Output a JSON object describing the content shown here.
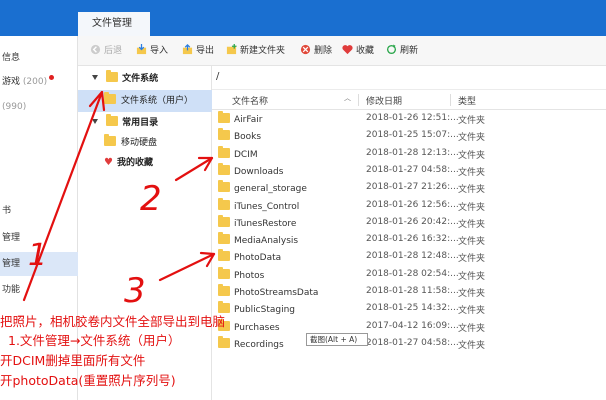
{
  "topbar": {
    "tab_label": "文件管理"
  },
  "leftnav": {
    "items": [
      {
        "label": "信息",
        "count": ""
      },
      {
        "label": "游戏",
        "count": "(200)"
      },
      {
        "label": "",
        "count": "(990)"
      },
      {
        "label": "书",
        "count": ""
      },
      {
        "label": "管理",
        "count": ""
      },
      {
        "label": "管理",
        "count": ""
      },
      {
        "label": "功能",
        "count": ""
      }
    ]
  },
  "toolbar": {
    "back": "后退",
    "import": "导入",
    "export": "导出",
    "new_folder": "新建文件夹",
    "delete": "删除",
    "favorite": "收藏",
    "refresh": "刷新"
  },
  "tree": {
    "root": "文件系统",
    "user": "文件系统（用户）",
    "common": "常用目录",
    "removable": "移动硬盘",
    "favorites": "我的收藏"
  },
  "path": "/",
  "columns": {
    "name": "文件名称",
    "date": "修改日期",
    "type": "类型"
  },
  "files": [
    {
      "name": "AirFair",
      "date": "2018-01-26 12:51:...",
      "type": "文件夹"
    },
    {
      "name": "Books",
      "date": "2018-01-25 15:07:...",
      "type": "文件夹"
    },
    {
      "name": "DCIM",
      "date": "2018-01-28 12:13:...",
      "type": "文件夹"
    },
    {
      "name": "Downloads",
      "date": "2018-01-27 04:58:...",
      "type": "文件夹"
    },
    {
      "name": "general_storage",
      "date": "2018-01-27 21:26:...",
      "type": "文件夹"
    },
    {
      "name": "iTunes_Control",
      "date": "2018-01-26 12:56:...",
      "type": "文件夹"
    },
    {
      "name": "iTunesRestore",
      "date": "2018-01-26 20:42:...",
      "type": "文件夹"
    },
    {
      "name": "MediaAnalysis",
      "date": "2018-01-26 16:32:...",
      "type": "文件夹"
    },
    {
      "name": "PhotoData",
      "date": "2018-01-28 12:48:...",
      "type": "文件夹"
    },
    {
      "name": "Photos",
      "date": "2018-01-28 02:54:...",
      "type": "文件夹"
    },
    {
      "name": "PhotoStreamsData",
      "date": "2018-01-28 11:58:...",
      "type": "文件夹"
    },
    {
      "name": "PublicStaging",
      "date": "2018-01-25 14:32:...",
      "type": "文件夹"
    },
    {
      "name": "Purchases",
      "date": "2017-04-12 16:09:...",
      "type": "文件夹"
    },
    {
      "name": "Recordings",
      "date": "2018-01-27 04:58:...",
      "type": "文件夹"
    }
  ],
  "tooltip": "截图(Alt + A)",
  "annotations": {
    "numbers": [
      "1",
      "2",
      "3"
    ],
    "lines": [
      "把照片，相机胶卷内文件全部导出到电脑",
      "1.文件管理→文件系统（用户）",
      "开DCIM删掉里面所有文件",
      "开photoData(重置照片序列号)"
    ]
  },
  "colors": {
    "accent": "#1a6fd0",
    "annotation": "#e31010",
    "folder": "#f5c84c",
    "selection": "#cfe0f7"
  }
}
